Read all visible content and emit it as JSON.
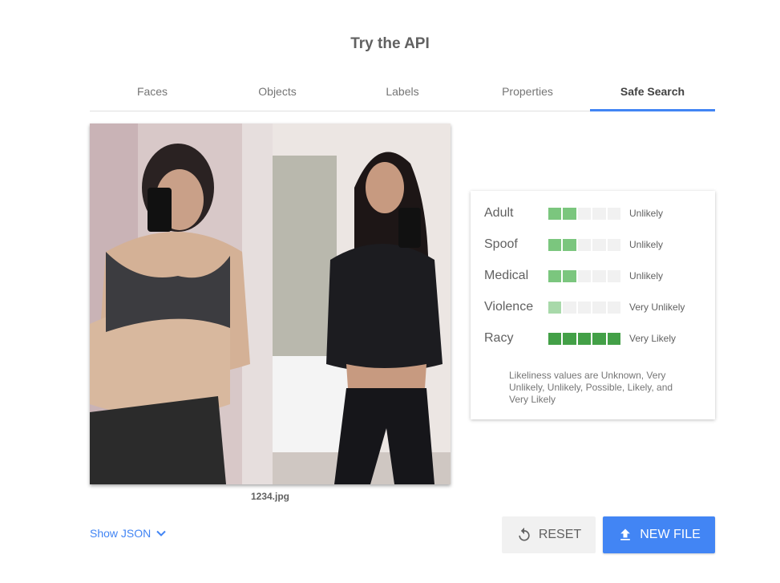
{
  "page": {
    "title": "Try the API"
  },
  "tabs": [
    {
      "label": "Faces",
      "active": false
    },
    {
      "label": "Objects",
      "active": false
    },
    {
      "label": "Labels",
      "active": false
    },
    {
      "label": "Properties",
      "active": false
    },
    {
      "label": "Safe Search",
      "active": true
    }
  ],
  "image": {
    "filename": "1234.jpg"
  },
  "safe_search": {
    "rows": [
      {
        "label": "Adult",
        "value": "Unlikely",
        "level": 2,
        "max_level": 5,
        "color": "#7bc67e"
      },
      {
        "label": "Spoof",
        "value": "Unlikely",
        "level": 2,
        "max_level": 5,
        "color": "#7bc67e"
      },
      {
        "label": "Medical",
        "value": "Unlikely",
        "level": 2,
        "max_level": 5,
        "color": "#7bc67e"
      },
      {
        "label": "Violence",
        "value": "Very Unlikely",
        "level": 1,
        "max_level": 5,
        "color": "#a8d9aa"
      },
      {
        "label": "Racy",
        "value": "Very Likely",
        "level": 5,
        "max_level": 5,
        "color": "#43a047"
      }
    ],
    "note": "Likeliness values are Unknown, Very Unlikely, Unlikely, Possible, Likely, and Very Likely"
  },
  "footer": {
    "show_json_label": "Show JSON",
    "reset_label": "RESET",
    "new_file_label": "NEW FILE"
  },
  "colors": {
    "accent": "#4285f4",
    "segment_empty": "#f1f1f1"
  },
  "icons": {
    "chevron": "chevron-down-icon",
    "reset": "reset-icon",
    "upload": "upload-icon"
  }
}
